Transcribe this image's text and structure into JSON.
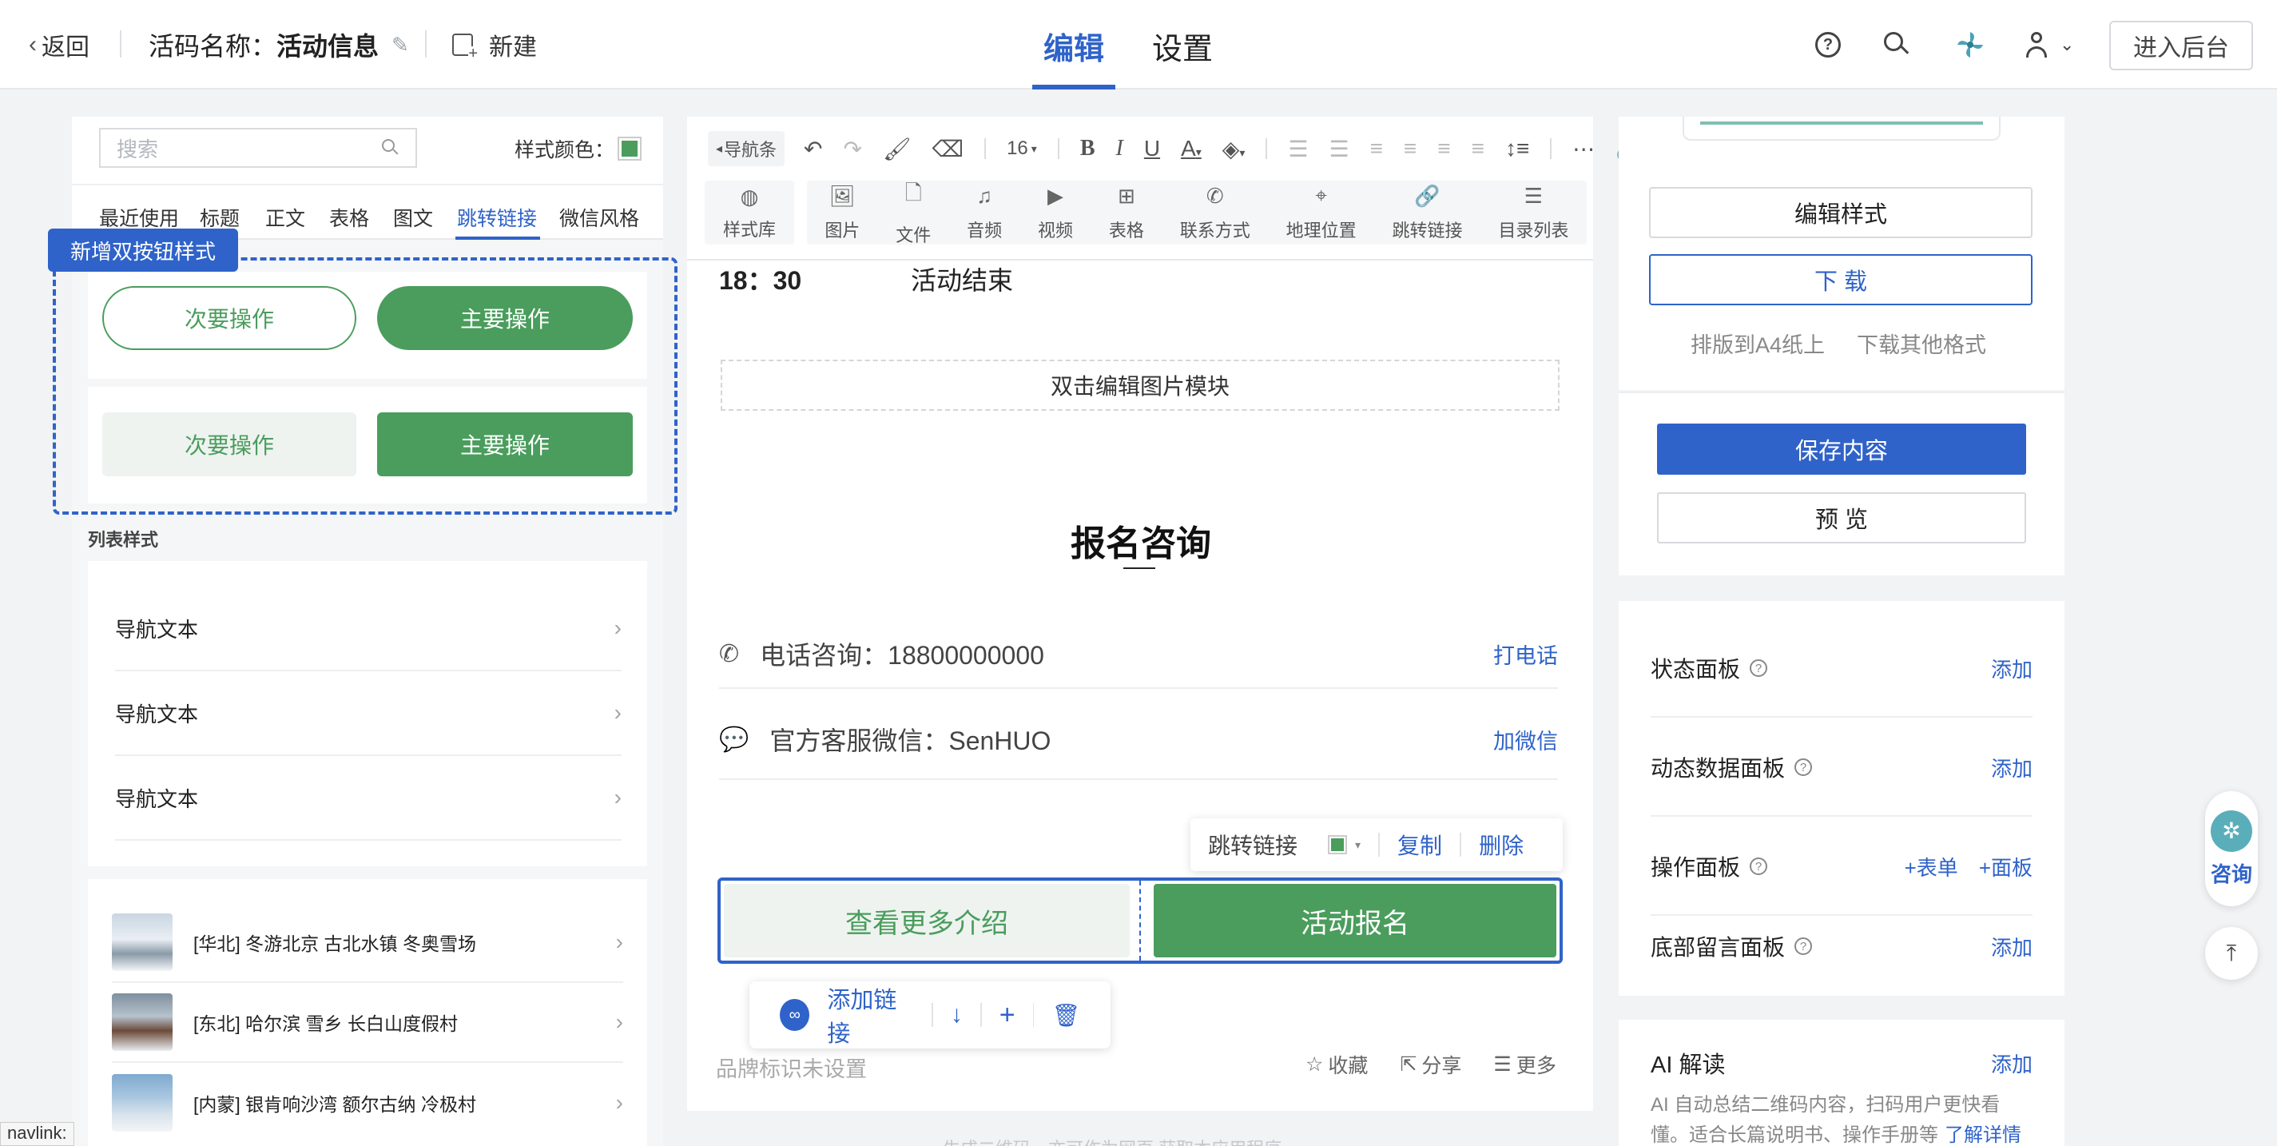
{
  "topbar": {
    "back_label": "返回",
    "code_name_prefix": "活码名称：",
    "code_name_value": "活动信息",
    "new_label": "新建",
    "tabs": [
      {
        "label": "编辑",
        "active": true
      },
      {
        "label": "设置",
        "active": false
      }
    ],
    "enter_backend_label": "进入后台"
  },
  "left": {
    "search_placeholder": "搜索",
    "style_color_label": "样式颜色：",
    "style_color": "#4a9d5c",
    "categories": [
      "最近使用",
      "标题",
      "正文",
      "表格",
      "图文",
      "跳转链接",
      "微信风格"
    ],
    "active_category": "跳转链接",
    "new_button_style_tag": "新增双按钮样式",
    "style1": {
      "secondary": "次要操作",
      "primary": "主要操作"
    },
    "style2": {
      "secondary": "次要操作",
      "primary": "主要操作"
    },
    "list_style_label": "列表样式",
    "nav_items": [
      "导航文本",
      "导航文本",
      "导航文本"
    ],
    "image_items": [
      "[华北] 冬游北京 古北水镇 冬奥雪场",
      "[东北] 哈尔滨 雪乡 长白山度假村",
      "[内蒙] 银肯响沙湾 额尔古纳 冷极村"
    ]
  },
  "editor": {
    "toolbar1": {
      "nav_label": "导航条",
      "font_size": "16"
    },
    "toolbar2": {
      "style_lib_label": "样式库",
      "items": [
        "图片",
        "文件",
        "音频",
        "视频",
        "表格",
        "联系方式",
        "地理位置",
        "跳转链接",
        "目录列表"
      ]
    },
    "time": "18：30",
    "time_event": "活动结束",
    "image_module_label": "双击编辑图片模块",
    "section_title": "报名咨询",
    "phone_text": "电话咨询：18800000000",
    "phone_action": "打电话",
    "wechat_text": "官方客服微信：SenHUO",
    "wechat_action": "加微信",
    "popover": {
      "label": "跳转链接",
      "copy": "复制",
      "delete": "删除"
    },
    "buttons": {
      "secondary": "查看更多介绍",
      "primary": "活动报名"
    },
    "link_bar": {
      "add_link": "添加链接"
    },
    "footer": {
      "brand": "品牌标识未设置",
      "fav": "收藏",
      "share": "分享",
      "more": "更多"
    },
    "bottom_note": "生成二维码，亦可作为网页 获取本应用程序"
  },
  "right": {
    "edit_style": "编辑样式",
    "download": "下 载",
    "a4_layout": "排版到A4纸上",
    "other_formats": "下载其他格式",
    "save_content": "保存内容",
    "preview": "预 览",
    "panels": [
      {
        "label": "状态面板",
        "actions": [
          "添加"
        ]
      },
      {
        "label": "动态数据面板",
        "actions": [
          "添加"
        ]
      },
      {
        "label": "操作面板",
        "actions": [
          "+表单",
          "+面板"
        ]
      },
      {
        "label": "底部留言面板",
        "actions": [
          "添加"
        ]
      }
    ],
    "ai_title": "AI 解读",
    "ai_add": "添加",
    "ai_desc": "AI 自动总结二维码内容，扫码用户更快看懂。适合长篇说明书、操作手册等",
    "ai_more": "了解详情"
  },
  "float": {
    "consult_label": "咨询"
  },
  "status_link": "navlink:",
  "colors": {
    "accent": "#2f63c9",
    "green": "#4a9d5c",
    "green_light": "#eef3f0"
  }
}
